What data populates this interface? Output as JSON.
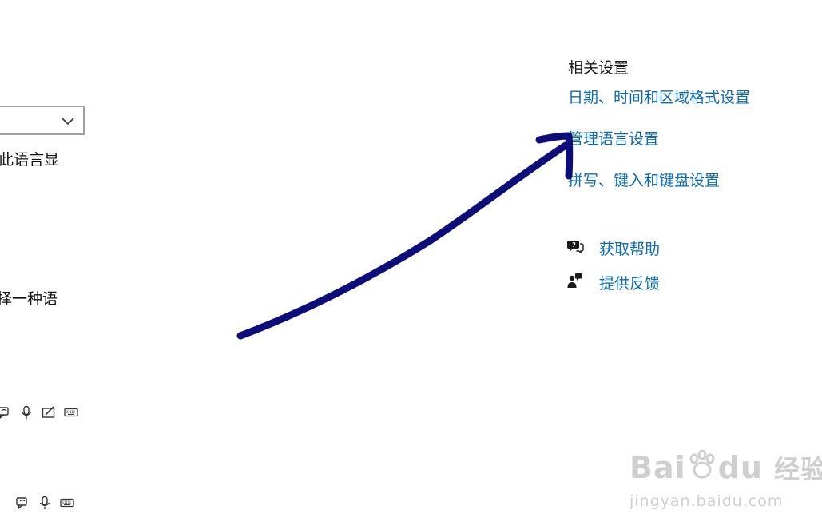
{
  "left_panel": {
    "text_display": "此语言显",
    "text_choose": "择一种语"
  },
  "related_settings": {
    "title": "相关设置",
    "links": [
      "日期、时间和区域格式设置",
      "管理语言设置",
      "拼写、键入和键盘设置"
    ]
  },
  "help": {
    "get_help": "获取帮助",
    "give_feedback": "提供反馈"
  },
  "watermark": {
    "logo_a": "Bai",
    "logo_b": "du",
    "logo_cn": "经验",
    "url": "jingyan.baidu.com"
  },
  "colors": {
    "link": "#0a6ab5",
    "annotation_arrow": "#0d0d7a"
  }
}
